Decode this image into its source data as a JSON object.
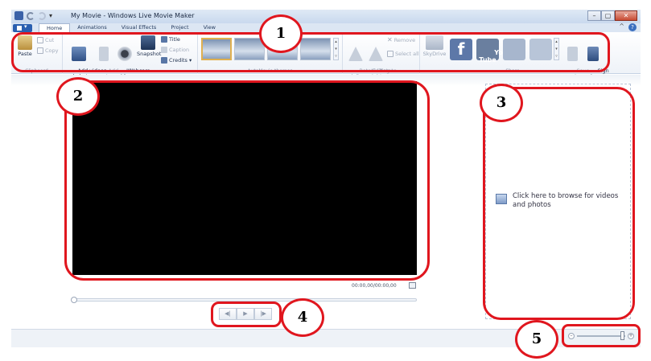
{
  "window": {
    "title": "My Movie - Windows Live Movie Maker",
    "qat_dropdown": "▾",
    "minimize": "–",
    "maximize": "▢",
    "close": "✕",
    "help": "?",
    "ribbon_minimize": "^"
  },
  "tabs": [
    {
      "label": "Home",
      "active": true
    },
    {
      "label": "Animations"
    },
    {
      "label": "Visual Effects"
    },
    {
      "label": "Project"
    },
    {
      "label": "View"
    }
  ],
  "ribbon": {
    "clipboard": {
      "label": "Clipboard",
      "paste": "Paste",
      "cut": "Cut",
      "copy": "Copy"
    },
    "add": {
      "label": "Add",
      "add_videos": "Add videos\nand photos",
      "add_music": "Add\nmusic ▾",
      "webcam": "Webcam\nvideo",
      "snapshot": "Snapshot",
      "title": "Title",
      "caption": "Caption",
      "credits": "Credits ▾"
    },
    "autoMovie": {
      "label": "AutoMovie themes"
    },
    "editing": {
      "label": "Editing",
      "rotate_left": "Rotate\nleft",
      "rotate_right": "Rotate\nright",
      "remove": "Remove",
      "select_all": "Select all"
    },
    "share": {
      "label": "Share",
      "skydrive": "SkyDrive",
      "facebook": "f",
      "youtube": "You\nTube",
      "save_movie": "Save\nmovie ▾",
      "sign_in": "Sign\nin"
    }
  },
  "preview": {
    "timecode": "00:00,00/00:00,00",
    "prev_frame": "◀|",
    "play": "▶",
    "next_frame": "|▶"
  },
  "storyboard": {
    "browse_text": "Click here to browse for videos and photos"
  },
  "zoom": {
    "minus": "–",
    "plus": "+"
  },
  "callouts": [
    "1",
    "2",
    "3",
    "4",
    "5"
  ],
  "colors": {
    "callout": "#e0161e",
    "preview_bg": "#000000",
    "ribbon_accent": "#2a5fb0"
  }
}
